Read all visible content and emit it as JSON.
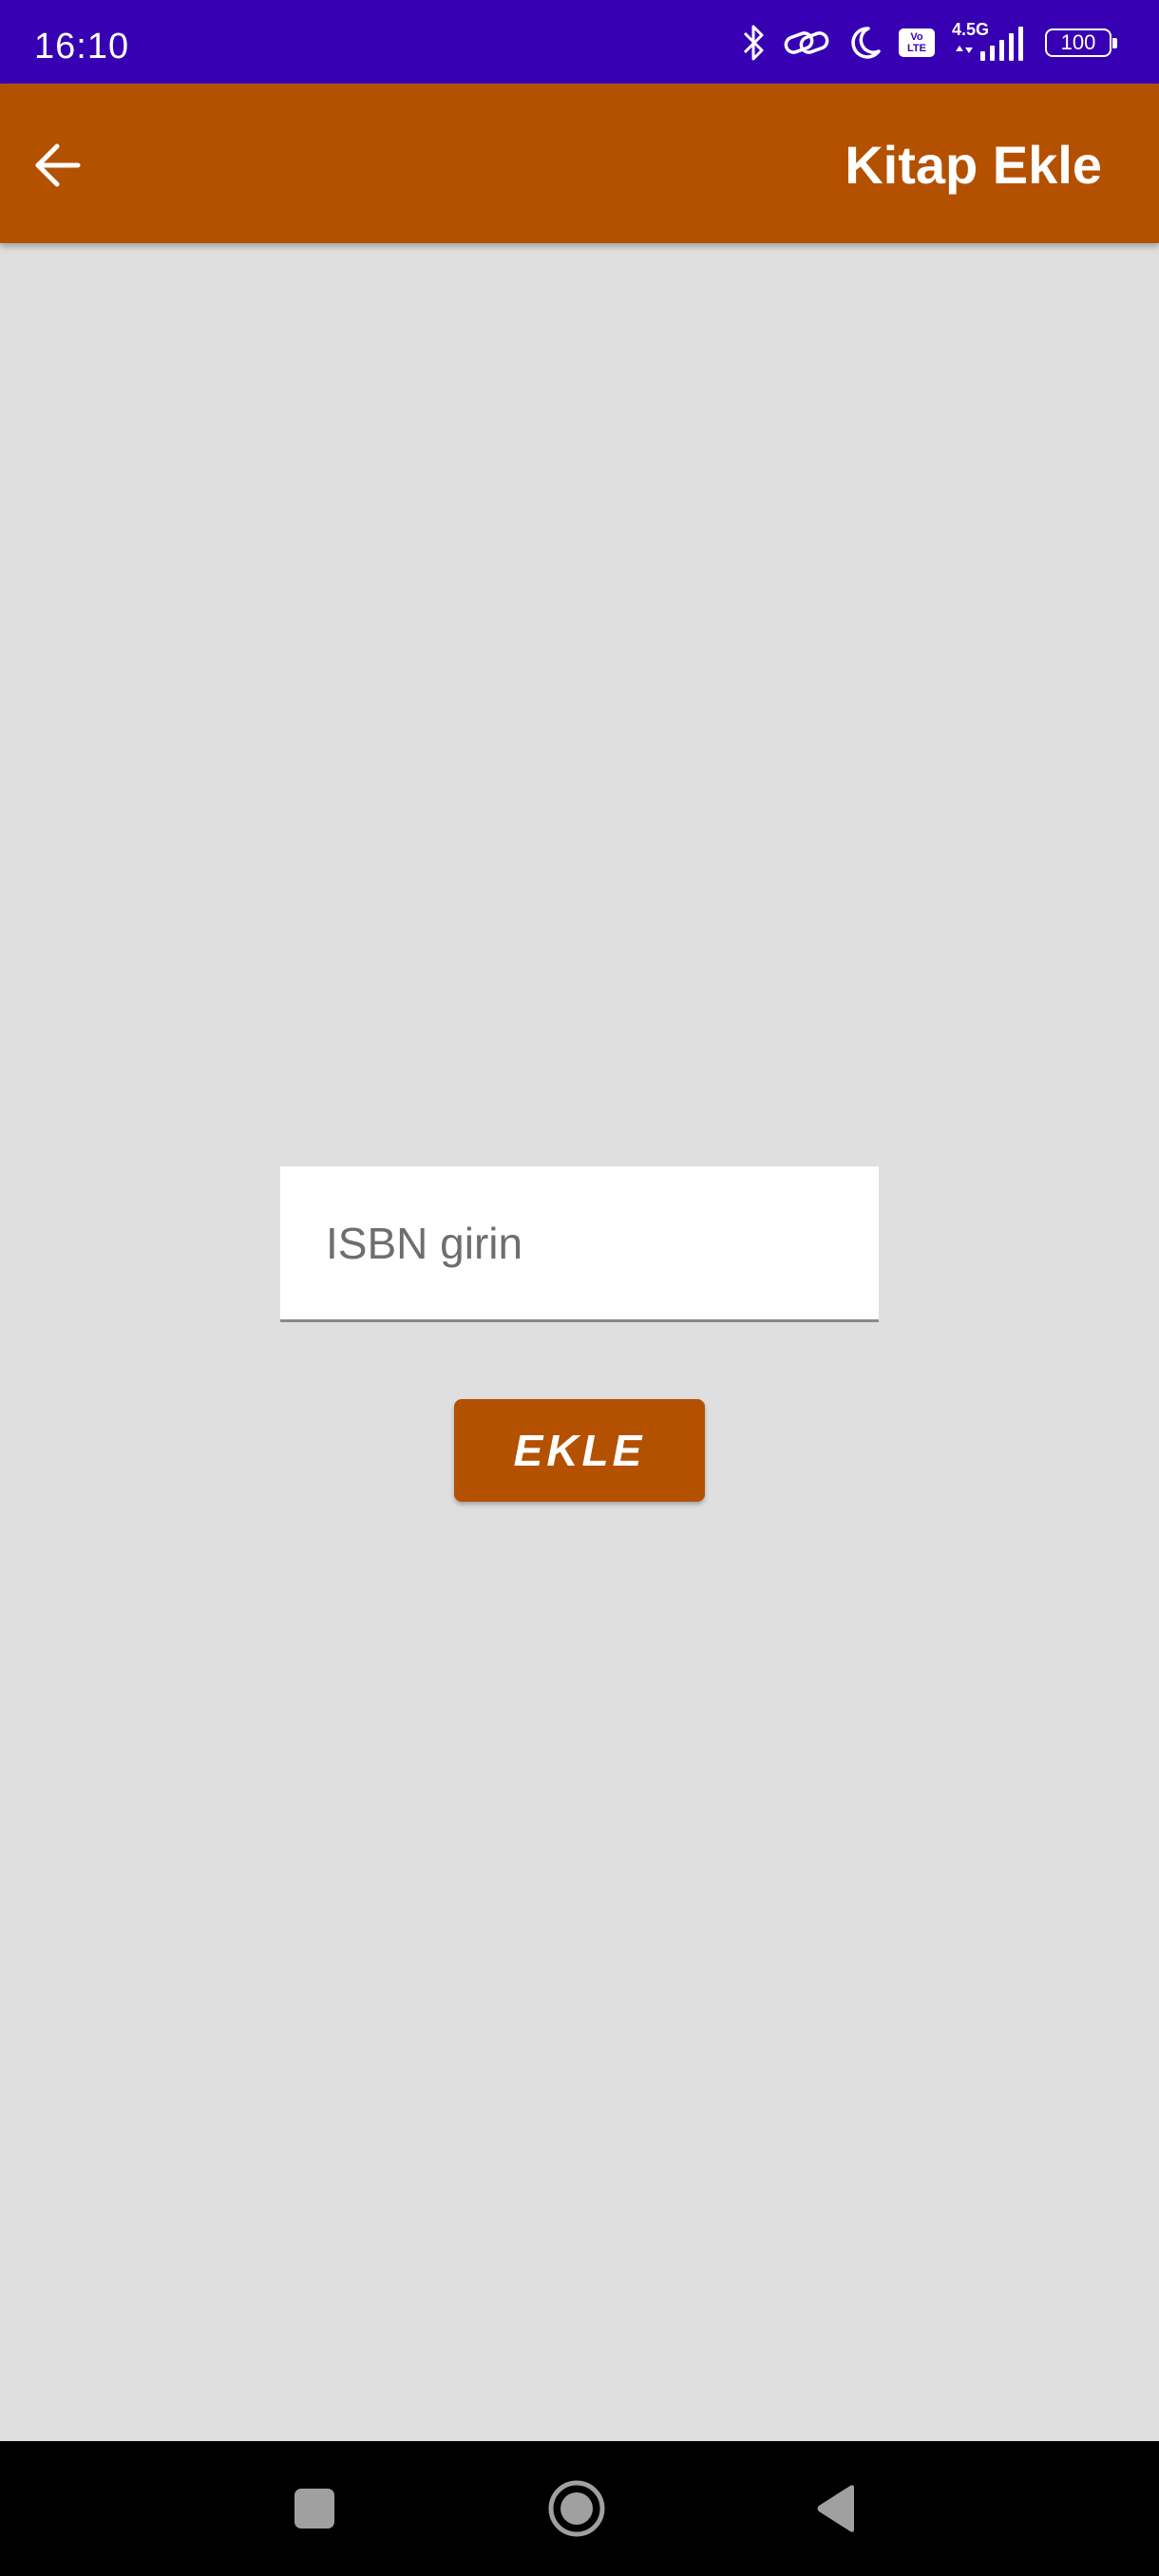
{
  "status_bar": {
    "time": "16:10",
    "network_label": "4.5G",
    "volte_top": "Vo",
    "volte_bottom": "LTE",
    "battery_level": "100",
    "icons": [
      "bluetooth-icon",
      "link-icon",
      "moon-icon",
      "volte-icon",
      "signal-icon",
      "battery-icon"
    ],
    "background_color": "#3700B3"
  },
  "app_bar": {
    "title": "Kitap Ekle",
    "back_icon": "arrow-left-icon",
    "background_color": "#B45100"
  },
  "form": {
    "isbn_placeholder": "ISBN girin",
    "isbn_value": "",
    "add_button_label": "EKLE",
    "button_color": "#B45100"
  },
  "nav_bar": {
    "buttons": [
      "recents-square-icon",
      "home-circle-icon",
      "back-triangle-icon"
    ]
  },
  "colors": {
    "background": "#DFDFDF"
  }
}
